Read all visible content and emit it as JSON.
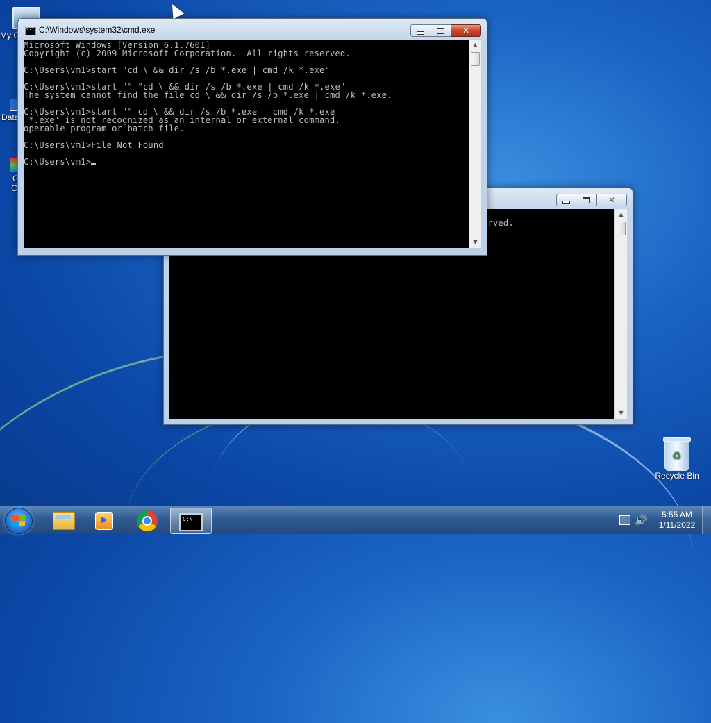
{
  "desktop": {
    "icons": [
      {
        "label": "My C"
      },
      {
        "label": "Data"
      },
      {
        "label": "G"
      },
      {
        "label": "C"
      },
      {
        "label": "Recycle Bin"
      }
    ]
  },
  "window_front": {
    "title": "C:\\Windows\\system32\\cmd.exe",
    "console_lines": [
      "Microsoft Windows [Version 6.1.7601]",
      "Copyright (c) 2009 Microsoft Corporation.  All rights reserved.",
      "",
      "C:\\Users\\vm1>start \"cd \\ && dir /s /b *.exe | cmd /k *.exe\"",
      "",
      "C:\\Users\\vm1>start \"\" \"cd \\ && dir /s /b *.exe | cmd /k *.exe\"",
      "The system cannot find the file cd \\ && dir /s /b *.exe | cmd /k *.exe.",
      "",
      "C:\\Users\\vm1>start \"\" cd \\ && dir /s /b *.exe | cmd /k *.exe",
      "'*.exe' is not recognized as an internal or external command,",
      "operable program or batch file.",
      "",
      "C:\\Users\\vm1>File Not Found",
      ""
    ],
    "prompt": "C:\\Users\\vm1>"
  },
  "window_back": {
    "visible_text": "erved."
  },
  "taskbar": {
    "items": [
      "start-button",
      "explorer",
      "media-player",
      "chrome",
      "cmd"
    ],
    "clock_time": "5:55 AM",
    "clock_date": "1/11/2022"
  },
  "colors": {
    "console_bg": "#000000",
    "console_fg": "#c0c0c0",
    "close_button": "#c8442a"
  }
}
